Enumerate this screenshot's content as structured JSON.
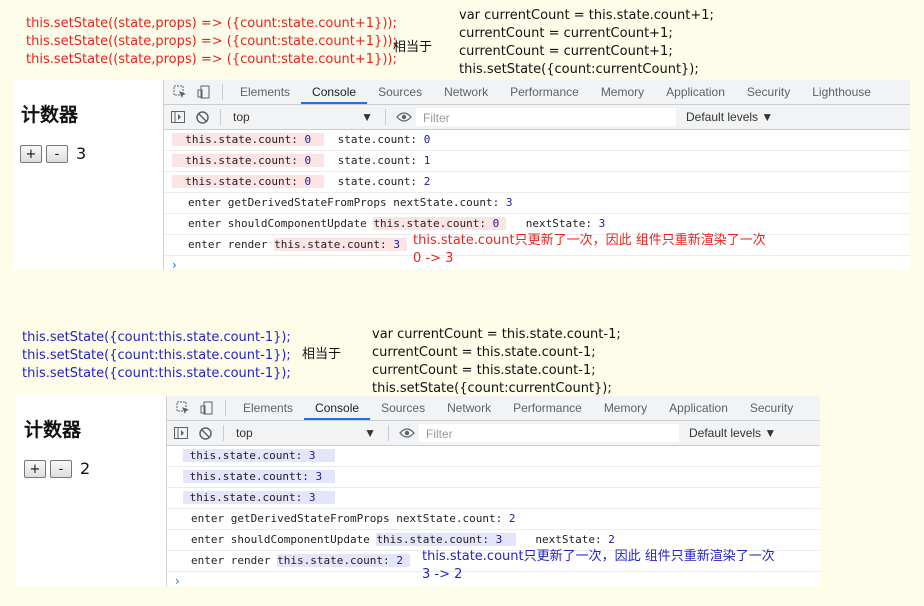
{
  "top": {
    "code_lines": [
      "this.setState((state,props) => ({count:state.count+1}));",
      "this.setState((state,props) => ({count:state.count+1}));",
      "this.setState((state,props) => ({count:state.count+1}));"
    ],
    "equivalent_label": "相当于",
    "equiv_lines": [
      "var currentCount = this.state.count+1;",
      "currentCount = currentCount+1;",
      "currentCount = currentCount+1;",
      "this.setState({count:currentCount});"
    ],
    "app": {
      "title": "计数器",
      "plus": "+",
      "minus": "-",
      "count": "3"
    },
    "tabs": [
      "Elements",
      "Console",
      "Sources",
      "Network",
      "Performance",
      "Memory",
      "Application",
      "Security",
      "Lighthouse"
    ],
    "active_tab": "Console",
    "context": "top",
    "filter_placeholder": "Filter",
    "levels": "Default levels",
    "console": [
      {
        "a": "this.state.count: ",
        "an": "0",
        "b": "  state.count: ",
        "bn": "0"
      },
      {
        "a": "this.state.count: ",
        "an": "0",
        "b": "  state.count: ",
        "bn": "1"
      },
      {
        "a": "this.state.count: ",
        "an": "0",
        "b": "  state.count: ",
        "bn": "2"
      },
      {
        "text": "enter getDerivedStateFromProps nextState.count: ",
        "n": "3"
      },
      {
        "pre": "enter shouldComponentUpdate ",
        "a": "this.state.count: ",
        "an": "0",
        "b": "   nextState: ",
        "bn": "3"
      },
      {
        "pre": "enter render ",
        "a": "this.state.count: ",
        "an": "3"
      }
    ],
    "annotation_1": "this.state.count只更新了一次，因此 组件只重新渲染了一次",
    "annotation_2": "0  -> 3",
    "prompt": "›"
  },
  "bottom": {
    "code_lines": [
      "this.setState({count:this.state.count-1});",
      "this.setState({count:this.state.count-1});",
      "this.setState({count:this.state.count-1});"
    ],
    "equivalent_label": "相当于",
    "equiv_lines": [
      "var currentCount = this.state.count-1;",
      "currentCount = this.state.count-1;",
      "currentCount = this.state.count-1;",
      "this.setState({count:currentCount});"
    ],
    "app": {
      "title": "计数器",
      "plus": "+",
      "minus": "-",
      "count": "2"
    },
    "tabs": [
      "Elements",
      "Console",
      "Sources",
      "Network",
      "Performance",
      "Memory",
      "Application",
      "Security"
    ],
    "active_tab": "Console",
    "context": "top",
    "filter_placeholder": "Filter",
    "levels": "Default levels",
    "console": [
      {
        "a": "this.state.count: ",
        "an": "3"
      },
      {
        "a": "this.state.countt: ",
        "an": "3"
      },
      {
        "a": "this.state.count: ",
        "an": "3"
      },
      {
        "text": "enter getDerivedStateFromProps nextState.count: ",
        "n": "2"
      },
      {
        "pre": "enter shouldComponentUpdate ",
        "a": "this.state.count: ",
        "an": "3",
        "b": "   nextState: ",
        "bn": "2"
      },
      {
        "pre": "enter render ",
        "a": "this.state.count: ",
        "an": "2"
      }
    ],
    "annotation_1": "this.state.count只更新了一次，因此 组件只重新渲染了一次",
    "annotation_2": "3 -> 2",
    "prompt": "›"
  },
  "colors": {
    "red": "#e8231e",
    "blue": "#2323c8",
    "page_bg": "#fefde9",
    "devtools_accent": "#1a73e8"
  }
}
